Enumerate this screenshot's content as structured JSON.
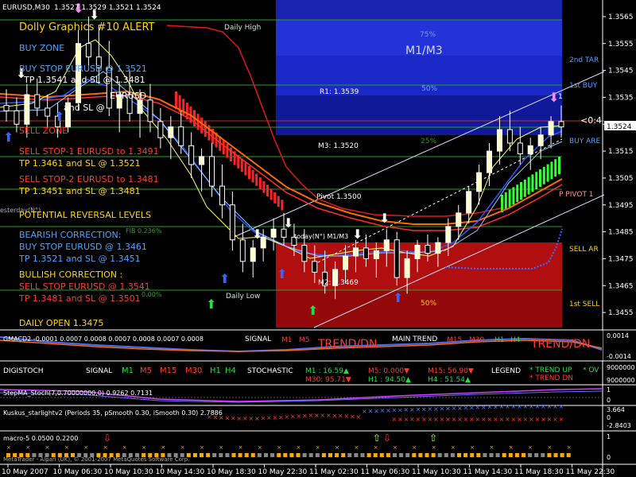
{
  "header": {
    "symbol": "EURUSD,M30",
    "ohlc": "1.3527 1.3529 1.3521 1.3524",
    "title": "Dolly Graphics #10 ALERT"
  },
  "levels": {
    "daily_high": "Daily High",
    "daily_low": "Daily Low",
    "m1m3": "M1/M3",
    "pct_75": "75%",
    "pct_50_top": "50%",
    "pct_25": "25%",
    "pct_50_bottom": "50%",
    "r1": "R1: 1.3539",
    "m3": "M3: 1.3520",
    "m2": "M2: 1.3469",
    "pivot": "Pivot 1.3500",
    "today": "today(N°) M1/M3",
    "fib": "FIB 0.236%",
    "pct_000": "0.00%",
    "yesterday": "esterday(N°)"
  },
  "right_labels": {
    "second_target": "2nd TAR",
    "first_buy": "1st BUY",
    "buy_area": "BUY ARE",
    "p_pivot": "P PIVOT 1",
    "sell_area": "SELL AR",
    "first_sell": "1st SELL",
    "mid_zero": "<0:4",
    "r1_short": "1"
  },
  "signals": {
    "buy_zone": "BUY ZONE",
    "buy_stop": "BUY STOP   EURUSD  @  1.3521",
    "tp1": "TP 1.3541 and SL @  1.3481",
    "eurusd_line": "EURUSD",
    "and_sl": "and SL @",
    "sell_zone": "SELL ZONE",
    "sell_stop1": "SELL STOP-1  EURUSD  to 1.3491",
    "tp_s1": "TP 1.3461 and SL @  1.3521",
    "sell_stop2": "SELL STOP-2  EURUSD  to 1.3481",
    "tp_s2": "TP 1.3451 and SL @  1.3481",
    "potential": "POTENTIAL REVERSAL LEVELS",
    "bearish": "BEARISH CORRECTION:",
    "buy_stop2": "BUY STOP EURUSD  @  1.3461",
    "tp_b2": "TP 1.3521 and SL @  1.3451",
    "bullish": "BULLISH CORRECTION :",
    "sell_stop3": "SELL STOP EURUSD  @  1.3541",
    "tp_s3": "TP 1.3481 and SL @  1.3501",
    "daily_open": "DAILY OPEN    1.3475"
  },
  "colors": {
    "buy": "#4aa3ff",
    "sell": "#ff3a2a",
    "neutral": "#ffd400",
    "band_blue": "#1525c8",
    "band_red": "#c21010",
    "line_green": "#2d9d2d"
  },
  "chart_data": {
    "type": "candlestick",
    "price_axis": [
      "1.3565",
      "1.3555",
      "1.3545",
      "1.3535",
      "1.3525",
      "1.3515",
      "1.3505",
      "1.3495",
      "1.3485",
      "1.3475",
      "1.3465",
      "1.3455"
    ],
    "current_price": "1.3524",
    "time_axis": [
      "10 May 2007",
      "10 May 06:30",
      "10 May 10:30",
      "10 May 14:30",
      "10 May 18:30",
      "10 May 22:30",
      "11 May 02:30",
      "11 May 06:30",
      "11 May 10:30",
      "11 May 14:30",
      "11 May 18:30",
      "11 May 22:30"
    ],
    "candles": [
      [
        1.3532,
        1.3538,
        1.3526,
        1.353
      ],
      [
        1.353,
        1.3535,
        1.3522,
        1.3525
      ],
      [
        1.3525,
        1.354,
        1.352,
        1.3536
      ],
      [
        1.3536,
        1.3542,
        1.3528,
        1.3531
      ],
      [
        1.3531,
        1.3536,
        1.3524,
        1.3528
      ],
      [
        1.3528,
        1.3533,
        1.352,
        1.3524
      ],
      [
        1.3524,
        1.3535,
        1.3522,
        1.3533
      ],
      [
        1.3533,
        1.356,
        1.353,
        1.3555
      ],
      [
        1.3555,
        1.3565,
        1.3545,
        1.355
      ],
      [
        1.355,
        1.3562,
        1.354,
        1.3546
      ],
      [
        1.3546,
        1.3556,
        1.3528,
        1.3531
      ],
      [
        1.3531,
        1.3541,
        1.3522,
        1.3536
      ],
      [
        1.3536,
        1.3545,
        1.3526,
        1.3529
      ],
      [
        1.3529,
        1.3538,
        1.352,
        1.3534
      ],
      [
        1.3534,
        1.354,
        1.3522,
        1.3526
      ],
      [
        1.3526,
        1.3531,
        1.3516,
        1.352
      ],
      [
        1.352,
        1.3528,
        1.3512,
        1.3524
      ],
      [
        1.3524,
        1.353,
        1.3514,
        1.3517
      ],
      [
        1.3517,
        1.3522,
        1.3505,
        1.351
      ],
      [
        1.351,
        1.3516,
        1.35,
        1.3513
      ],
      [
        1.3513,
        1.3518,
        1.3498,
        1.3502
      ],
      [
        1.3502,
        1.351,
        1.349,
        1.3495
      ],
      [
        1.3495,
        1.35,
        1.3478,
        1.3482
      ],
      [
        1.3482,
        1.3488,
        1.347,
        1.3474
      ],
      [
        1.3474,
        1.3482,
        1.3468,
        1.3479
      ],
      [
        1.3479,
        1.3486,
        1.3474,
        1.3483
      ],
      [
        1.3483,
        1.349,
        1.3478,
        1.3486
      ],
      [
        1.3486,
        1.3492,
        1.348,
        1.3483
      ],
      [
        1.3483,
        1.3488,
        1.3476,
        1.348
      ],
      [
        1.348,
        1.3486,
        1.347,
        1.3474
      ],
      [
        1.3474,
        1.348,
        1.3466,
        1.347
      ],
      [
        1.347,
        1.3478,
        1.3462,
        1.3465
      ],
      [
        1.3465,
        1.3474,
        1.346,
        1.3471
      ],
      [
        1.3471,
        1.348,
        1.3466,
        1.3476
      ],
      [
        1.3476,
        1.3482,
        1.347,
        1.3479
      ],
      [
        1.3479,
        1.3484,
        1.3472,
        1.3475
      ],
      [
        1.3475,
        1.3481,
        1.3468,
        1.3478
      ],
      [
        1.3478,
        1.3486,
        1.3472,
        1.3482
      ],
      [
        1.3482,
        1.3485,
        1.3465,
        1.3468
      ],
      [
        1.3468,
        1.3478,
        1.3462,
        1.3475
      ],
      [
        1.3475,
        1.3482,
        1.347,
        1.348
      ],
      [
        1.348,
        1.3484,
        1.3474,
        1.3477
      ],
      [
        1.3477,
        1.3483,
        1.3472,
        1.3481
      ],
      [
        1.3481,
        1.349,
        1.3476,
        1.3487
      ],
      [
        1.3487,
        1.3495,
        1.3482,
        1.3492
      ],
      [
        1.3492,
        1.3502,
        1.3488,
        1.35
      ],
      [
        1.35,
        1.351,
        1.3495,
        1.3507
      ],
      [
        1.3507,
        1.3518,
        1.3502,
        1.3515
      ],
      [
        1.3515,
        1.3528,
        1.351,
        1.3523
      ],
      [
        1.3523,
        1.353,
        1.3515,
        1.3518
      ],
      [
        1.3518,
        1.3524,
        1.351,
        1.3514
      ],
      [
        1.3514,
        1.352,
        1.3508,
        1.3517
      ],
      [
        1.3517,
        1.3524,
        1.3512,
        1.3521
      ],
      [
        1.3521,
        1.3528,
        1.3516,
        1.3526
      ],
      [
        1.3526,
        1.3532,
        1.352,
        1.3524
      ]
    ],
    "ylim": [
      1.345,
      1.357
    ]
  },
  "indicators": {
    "gmacd": {
      "label": "GMACD2 -0.0001 0.0007 0.0008 0.0007 0.0008 0.0007 0.0008",
      "signal": "SIGNAL",
      "m1": "M1",
      "m5": "M5",
      "trend_dn_label": "TREND/DN",
      "main_trend": "MAIN TREND",
      "m15": "M15",
      "m30": "M30",
      "h1": "H1",
      "h4": "H4",
      "trend_dn_right": "TREND/DN",
      "scale": [
        "0.0014",
        "-0.0014"
      ]
    },
    "digistoch": {
      "label": "DIGISTOCH",
      "signal": "SIGNAL",
      "m1": "M1",
      "m5": "M5",
      "m15": "M15",
      "m30": "M30",
      "h1": "H1",
      "h4": "H4",
      "stochastic": "STOCHASTIC",
      "s_m1": "M1 : 16.59▲",
      "s_m5": "M5: 0.000▼",
      "s_m15": "M15: 56.90▼",
      "s_m30": "M30: 95.71▼",
      "s_h1": "H1 : 94.50▲",
      "s_h4": "H4  : 51.54▲",
      "legend": "LEGEND",
      "trend_up": "* TREND UP",
      "trend_dn": "* TREND DN",
      "ov": "* OV",
      "scale": [
        "9000000",
        "9000000"
      ]
    },
    "stepma": {
      "label": "StepMA_Stoch(7,0.70000000,0) 0.9262 0.7131",
      "scale": [
        "1",
        "0"
      ]
    },
    "kuskus": {
      "label": "Kuskus_starlightv2  (Periods 35, pSmooth 0.30, iSmooth 0.30)  2.7886",
      "scale": [
        "3.664",
        "0",
        "-2.8403"
      ]
    },
    "macro": {
      "label": "macro-5 0.0500 0.2200",
      "scale": [
        "1",
        "0"
      ]
    },
    "copyright": "MetaTrader - Alpari (UK), © 2001-2007 MetaQuotes Software Corp."
  }
}
